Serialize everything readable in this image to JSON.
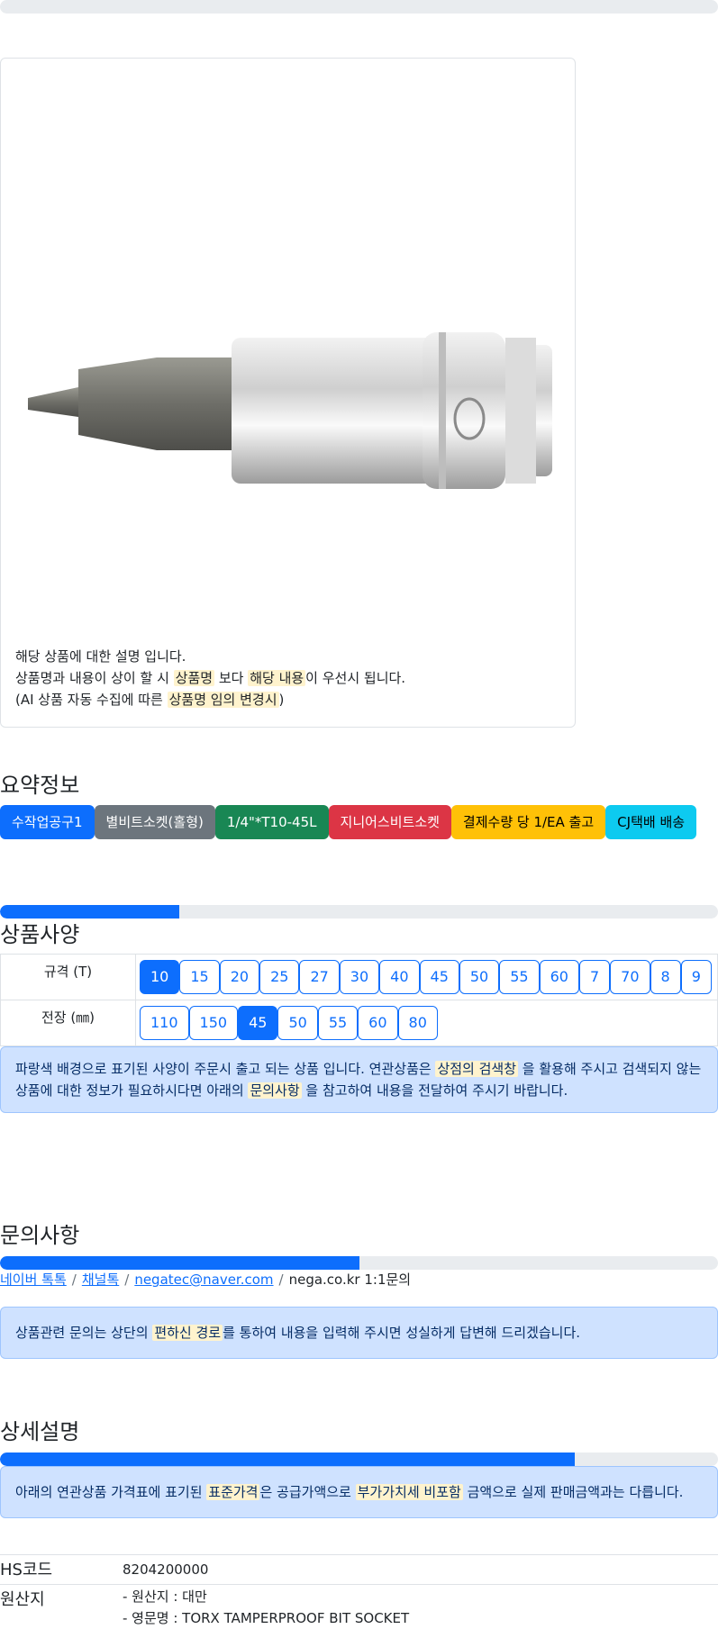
{
  "progress": {
    "top_bar": 0,
    "spec_bar": 0.25,
    "inquiry_bar": 0.5,
    "detail_bar": 0.8
  },
  "product_image": {
    "alt": "TORX tamperproof bit socket"
  },
  "note": {
    "line1": "해당 상품에 대한 설명 입니다.",
    "line2_a": "상품명과 내용이 상이 할 시 ",
    "line2_hl1": "상품명",
    "line2_b": " 보다 ",
    "line2_hl2": "해당 내용",
    "line2_c": "이 우선시 됩니다.",
    "line3_a": "(AI 상품 자동 수집에 따른 ",
    "line3_hl": "상품명 임의 변경시",
    "line3_b": ")"
  },
  "summary": {
    "title": "요약정보",
    "badges": [
      "수작업공구1",
      "별비트소켓(홀형)",
      "1/4\"*T10-45L",
      "지니어스비트소켓",
      "결제수량 당 1/EA 출고",
      "CJ택배 배송"
    ]
  },
  "spec": {
    "title": "상품사양",
    "rows": [
      {
        "label": "규격 (T)",
        "options": [
          "10",
          "15",
          "20",
          "25",
          "27",
          "30",
          "40",
          "45",
          "50",
          "55",
          "60",
          "7",
          "70",
          "8",
          "9"
        ],
        "selected": "10"
      },
      {
        "label": "전장 (㎜)",
        "options": [
          "110",
          "150",
          "45",
          "50",
          "55",
          "60",
          "80"
        ],
        "selected": "45"
      }
    ],
    "info_a": "파랑색 배경으로 표기된 사양이 주문시 출고 되는 상품 입니다. 연관상품은 ",
    "info_hl1": "상점의 검색창",
    "info_b": " 을 활용해 주시고 검색되지 않는",
    "info_c": "상품에 대한 정보가 필요하시다면 아래의 ",
    "info_hl2": "문의사항",
    "info_d": " 을 참고하여 내용을 전달하여 주시기 바랍니다."
  },
  "inquiry": {
    "title": "문의사항",
    "links": [
      "네이버 톡톡",
      "채널톡",
      "negatec@naver.com"
    ],
    "plain": "nega.co.kr 1:1문의",
    "separator": "/",
    "info_a": "상품관련 문의는 상단의 ",
    "info_hl": "편하신 경로",
    "info_b": "를 통하여 내용을 입력해 주시면 성실하게 답변해 드리겠습니다."
  },
  "detail": {
    "title": "상세설명",
    "info_a": "아래의 연관상품 가격표에 표기된 ",
    "info_hl1": "표준가격",
    "info_b": "은 공급가액으로 ",
    "info_hl2": "부가가치세 비포함",
    "info_c": " 금액으로 실제 판매금액과는 다릅니다.",
    "hs_label": "HS코드",
    "hs_value": "8204200000",
    "origin_label": "원산지",
    "origin_line1": "- 원산지 : 대만",
    "origin_line2": "- 영문명 : TORX TAMPERPROOF BIT SOCKET"
  },
  "colors": {
    "primary": "#0d6efd",
    "alert_bg": "#cfe2ff",
    "highlight": "#fff3cd"
  }
}
